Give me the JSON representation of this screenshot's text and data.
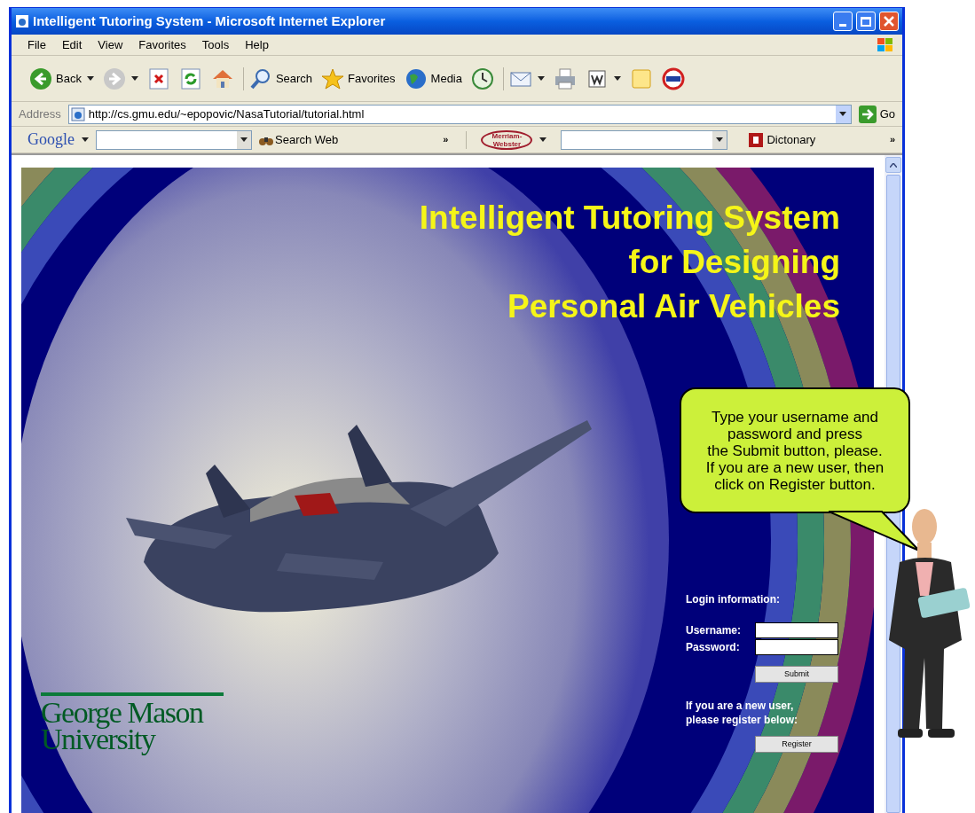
{
  "window": {
    "title": "Intelligent Tutoring System - Microsoft Internet Explorer"
  },
  "menu": [
    "File",
    "Edit",
    "View",
    "Favorites",
    "Tools",
    "Help"
  ],
  "toolbar": [
    {
      "kind": "back",
      "label": "Back",
      "dropdown": true
    },
    {
      "kind": "forward",
      "dropdown": true
    },
    {
      "kind": "stop"
    },
    {
      "kind": "refresh"
    },
    {
      "kind": "home"
    },
    {
      "kind": "search",
      "label": "Search"
    },
    {
      "kind": "favorites",
      "label": "Favorites"
    },
    {
      "kind": "media",
      "label": "Media"
    },
    {
      "kind": "history"
    },
    {
      "kind": "mail",
      "dropdown": true
    },
    {
      "kind": "print"
    },
    {
      "kind": "word",
      "dropdown": true
    },
    {
      "kind": "note"
    },
    {
      "kind": "badge"
    }
  ],
  "address": {
    "label": "Address",
    "url": "http://cs.gmu.edu/~epopovic/NasaTutorial/tutorial.html",
    "go": "Go"
  },
  "links_bar": {
    "google": "Google",
    "search_web": "Search Web",
    "chevron": "»",
    "merriam": "Merriam-Webster",
    "dictionary": "Dictonary",
    "chevron_2": "»"
  },
  "page": {
    "title": "Intelligent Tutoring System\nfor Designing\nPersonal Air Vehicles",
    "speech": "Type your username and\npassword and press\nthe Submit button, please.\nIf you are a new user, then\nclick on Register button.",
    "login_heading": "Login information:",
    "fields": [
      {
        "label": "Username:"
      },
      {
        "label": "Password:"
      }
    ],
    "submit": "Submit",
    "register_prompt": "If you are a new user,\nplease register below:",
    "register": "Register",
    "logo": "George Mason\nUniversity"
  }
}
